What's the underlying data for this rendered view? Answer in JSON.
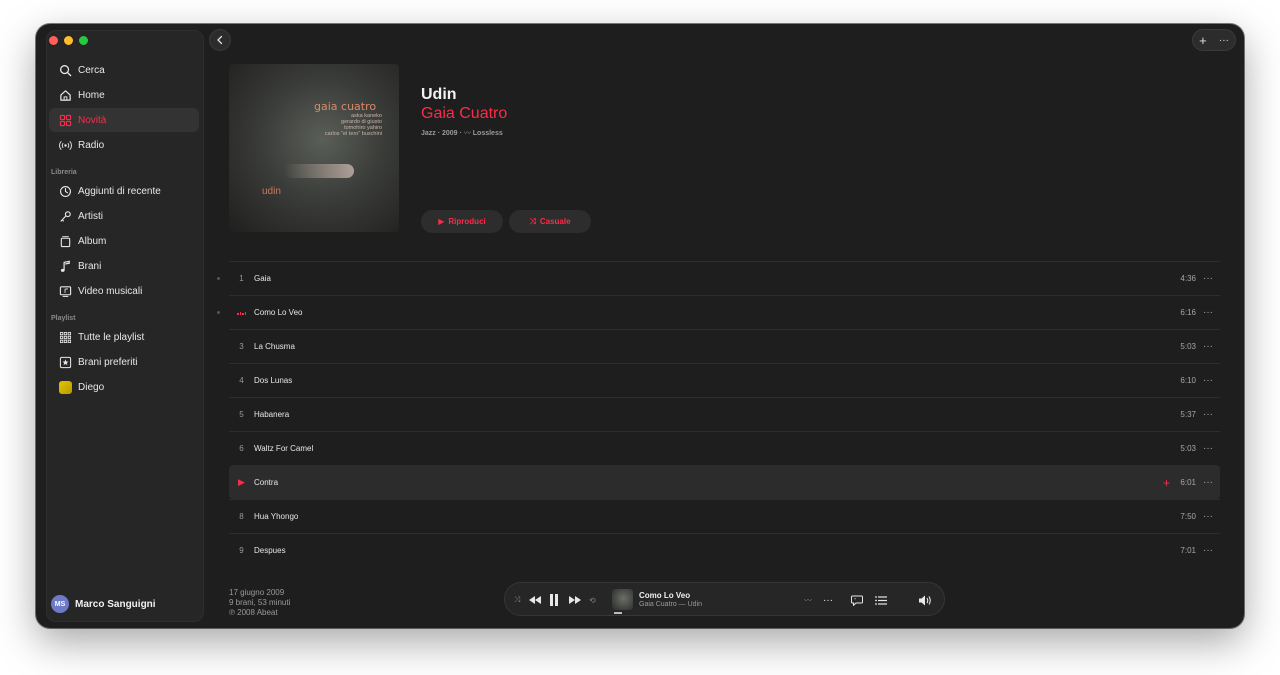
{
  "sidebar": {
    "items": [
      {
        "label": "Cerca",
        "icon": "search-icon"
      },
      {
        "label": "Home",
        "icon": "home-icon"
      },
      {
        "label": "Novità",
        "icon": "grid-icon",
        "active": true
      },
      {
        "label": "Radio",
        "icon": "radio-icon"
      }
    ],
    "library_label": "Libreria",
    "library": [
      {
        "label": "Aggiunti di recente",
        "icon": "clock-icon"
      },
      {
        "label": "Artisti",
        "icon": "microphone-icon"
      },
      {
        "label": "Album",
        "icon": "album-icon"
      },
      {
        "label": "Brani",
        "icon": "music-note-icon"
      },
      {
        "label": "Video musicali",
        "icon": "video-icon"
      }
    ],
    "playlist_label": "Playlist",
    "playlists": [
      {
        "label": "Tutte le playlist",
        "icon": "grid-dots-icon"
      },
      {
        "label": "Brani preferiti",
        "icon": "star-icon"
      },
      {
        "label": "Diego",
        "icon": "playlist-thumb"
      }
    ],
    "user": {
      "initials": "MS",
      "name": "Marco Sanguigni"
    }
  },
  "topbar": {
    "add": "+",
    "more": "···"
  },
  "album": {
    "title": "Udin",
    "artist": "Gaia Cuatro",
    "meta": "Jazz · 2009 · ",
    "lossless": "Lossless",
    "cover": {
      "band": "gaia cuatro",
      "members": [
        "aska kaneko",
        "gerardo di giusto",
        "tomohiro yahiro",
        "carlos \"el tero\" buschini"
      ],
      "title": "udin"
    },
    "play_label": "Riproduci",
    "shuffle_label": "Casuale"
  },
  "tracks": [
    {
      "num": "1",
      "name": "Gaia",
      "duration": "4:36",
      "dot": true
    },
    {
      "num": "",
      "name": "Como Lo Veo",
      "duration": "6:16",
      "dot": true,
      "playing": true
    },
    {
      "num": "3",
      "name": "La Chusma",
      "duration": "5:03"
    },
    {
      "num": "4",
      "name": "Dos Lunas",
      "duration": "6:10"
    },
    {
      "num": "5",
      "name": "Habanera",
      "duration": "5:37"
    },
    {
      "num": "6",
      "name": "Waltz For Camel",
      "duration": "5:03"
    },
    {
      "num": "",
      "name": "Contra",
      "duration": "6:01",
      "hover": true
    },
    {
      "num": "8",
      "name": "Hua Yhongo",
      "duration": "7:50"
    },
    {
      "num": "9",
      "name": "Despues",
      "duration": "7:01"
    }
  ],
  "footer": {
    "date": "17 giugno 2009",
    "summary": "9 brani, 53 minuti",
    "copyright": "℗ 2008 Abeat"
  },
  "player": {
    "title": "Como Lo Veo",
    "subtitle": "Gaia Cuatro — Udin"
  },
  "colors": {
    "accent": "#fa2d48",
    "bg": "#1e1e1e",
    "sidebar": "#262626"
  }
}
